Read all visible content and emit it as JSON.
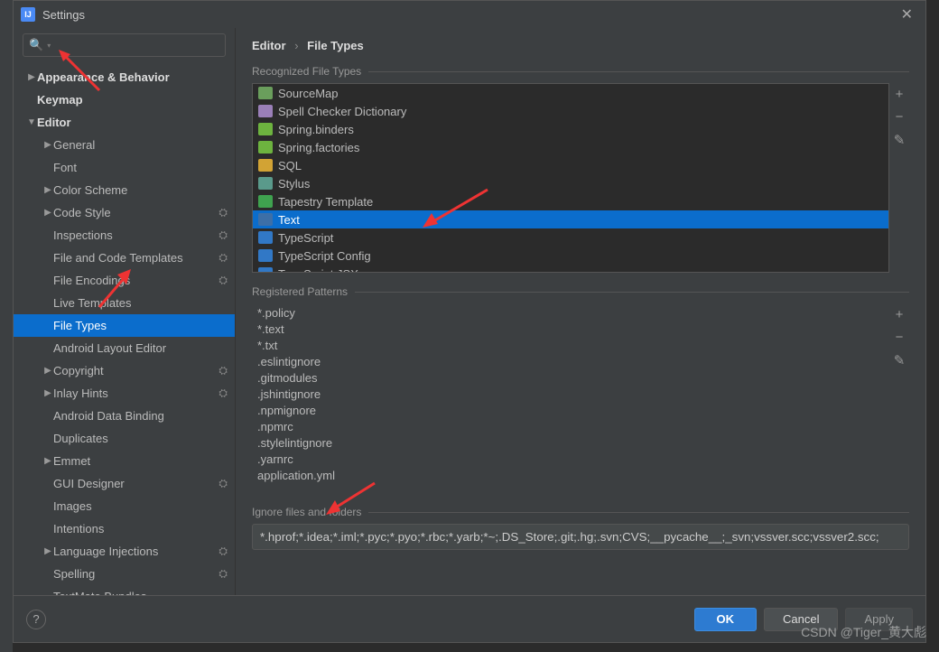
{
  "window": {
    "title": "Settings"
  },
  "search": {
    "placeholder": ""
  },
  "breadcrumb": {
    "a": "Editor",
    "b": "File Types"
  },
  "tree": [
    {
      "label": "Appearance & Behavior",
      "depth": 0,
      "arrow": "▶",
      "bold": true
    },
    {
      "label": "Keymap",
      "depth": 0,
      "bold": true
    },
    {
      "label": "Editor",
      "depth": 0,
      "arrow": "▼",
      "bold": true
    },
    {
      "label": "General",
      "depth": 1,
      "arrow": "▶"
    },
    {
      "label": "Font",
      "depth": 1
    },
    {
      "label": "Color Scheme",
      "depth": 1,
      "arrow": "▶"
    },
    {
      "label": "Code Style",
      "depth": 1,
      "arrow": "▶",
      "gear": true
    },
    {
      "label": "Inspections",
      "depth": 1,
      "gear": true
    },
    {
      "label": "File and Code Templates",
      "depth": 1,
      "gear": true
    },
    {
      "label": "File Encodings",
      "depth": 1,
      "gear": true
    },
    {
      "label": "Live Templates",
      "depth": 1
    },
    {
      "label": "File Types",
      "depth": 1,
      "selected": true
    },
    {
      "label": "Android Layout Editor",
      "depth": 1
    },
    {
      "label": "Copyright",
      "depth": 1,
      "arrow": "▶",
      "gear": true
    },
    {
      "label": "Inlay Hints",
      "depth": 1,
      "arrow": "▶",
      "gear": true
    },
    {
      "label": "Android Data Binding",
      "depth": 1
    },
    {
      "label": "Duplicates",
      "depth": 1
    },
    {
      "label": "Emmet",
      "depth": 1,
      "arrow": "▶"
    },
    {
      "label": "GUI Designer",
      "depth": 1,
      "gear": true
    },
    {
      "label": "Images",
      "depth": 1
    },
    {
      "label": "Intentions",
      "depth": 1
    },
    {
      "label": "Language Injections",
      "depth": 1,
      "arrow": "▶",
      "gear": true
    },
    {
      "label": "Spelling",
      "depth": 1,
      "gear": true
    },
    {
      "label": "TextMate Bundles",
      "depth": 1
    }
  ],
  "sections": {
    "recognized": "Recognized File Types",
    "patterns": "Registered Patterns",
    "ignore": "Ignore files and folders"
  },
  "filetypes": [
    {
      "label": "SourceMap",
      "color": "#6a9e5c"
    },
    {
      "label": "Spell Checker Dictionary",
      "color": "#9a7fb8"
    },
    {
      "label": "Spring.binders",
      "color": "#6db33f"
    },
    {
      "label": "Spring.factories",
      "color": "#6db33f"
    },
    {
      "label": "SQL",
      "color": "#d2a334"
    },
    {
      "label": "Stylus",
      "color": "#5a9a8b"
    },
    {
      "label": "Tapestry Template",
      "color": "#3fa24f"
    },
    {
      "label": "Text",
      "color": "#3d6fa7",
      "selected": true
    },
    {
      "label": "TypeScript",
      "color": "#3178c6"
    },
    {
      "label": "TypeScript Config",
      "color": "#3178c6"
    },
    {
      "label": "TypeScript JSX",
      "color": "#3178c6"
    }
  ],
  "patterns": [
    "*.policy",
    "*.text",
    "*.txt",
    ".eslintignore",
    ".gitmodules",
    ".jshintignore",
    ".npmignore",
    ".npmrc",
    ".stylelintignore",
    ".yarnrc",
    "application.yml"
  ],
  "ignore_value": "*.hprof;*.idea;*.iml;*.pyc;*.pyo;*.rbc;*.yarb;*~;.DS_Store;.git;.hg;.svn;CVS;__pycache__;_svn;vssver.scc;vssver2.scc;",
  "buttons": {
    "ok": "OK",
    "cancel": "Cancel",
    "apply": "Apply"
  },
  "tool": {
    "add": "+",
    "remove": "−",
    "edit": "✎"
  },
  "watermark": "CSDN @Tiger_黄大彪"
}
